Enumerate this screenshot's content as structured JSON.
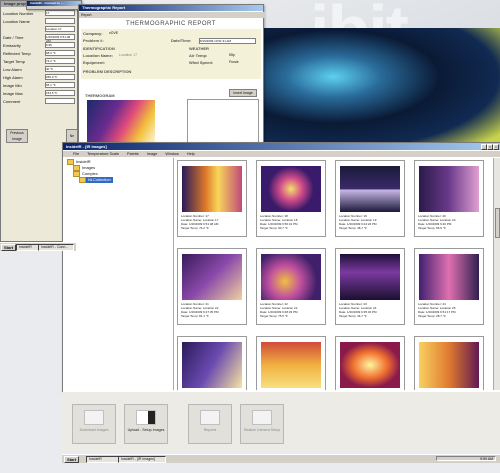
{
  "background_text": "ibit",
  "left_panel": {
    "title": "Image properties",
    "fields": [
      {
        "label": "Location Number",
        "value": "17"
      },
      {
        "label": "Location Name",
        "value": ""
      },
      {
        "label": "",
        "value": "Location 17"
      },
      {
        "label": "Date / Time",
        "value": "1/20/2009 6:51:48 AM"
      },
      {
        "label": "Emissivity",
        "value": "0.95"
      },
      {
        "label": "Reflected Temp",
        "value": "68.0 °F"
      },
      {
        "label": "Target Temp",
        "value": "74.2 °F"
      },
      {
        "label": "Low Alarm",
        "value": "40 °F"
      },
      {
        "label": "High Alarm",
        "value": "266.0 °F"
      },
      {
        "label": "Image Min",
        "value": "66.1 °F"
      },
      {
        "label": "Image Max",
        "value": "153.5 °F"
      },
      {
        "label": "Comment",
        "value": ""
      }
    ],
    "prev_button": "Previous Image",
    "next_button": "Ne"
  },
  "report_window": {
    "title": "Thermographic Report",
    "menu": "Report",
    "heading": "THERMOGRAPHIC REPORT",
    "company_label": "Company:",
    "company_value": "xOVE",
    "problem_label": "Problem #:",
    "datetime_label": "Date/Time:",
    "datetime_value": "5/10/2009 10:51:31 AM",
    "identification": "IDENTIFICATION",
    "weather": "WEATHER",
    "location_name_label": "Location Name:",
    "location_name_value": "Location 17",
    "air_temp_label": "Air Temp:",
    "air_temp_value": "55p",
    "equipment_label": "Equipment:",
    "wind_label": "Wind Speed:",
    "wind_value": "Frosie",
    "problem_desc": "PROBLEM DESCRIPTION",
    "thermogram": "THERMOGRAM",
    "insert_image": "Insert Image"
  },
  "back_window_title": "InsideIR - Connect to ...",
  "main_window": {
    "title": "InsideIR - [IR Images]",
    "menu": [
      "File",
      "Temperature Scale",
      "Palette",
      "Image",
      "Window",
      "Help"
    ],
    "tree": {
      "root": "InsideIR",
      "items": [
        "Images",
        "Complex",
        "NLCollection"
      ]
    },
    "thumbs": [
      {
        "number": "Location Number: 17",
        "name": "Location Name: Location 17",
        "date": "Date: 1/20/2009 6:51:48 AM",
        "temp": "Target Temp: 74.2 °F"
      },
      {
        "number": "Location Number: 18",
        "name": "Location Name: Location 18",
        "date": "Date: 1/20/2009 6:50:31 PM",
        "temp": "Target Temp: 90.7 °F"
      },
      {
        "number": "Location Number: 19",
        "name": "Location Name: Location 19",
        "date": "Date: 1/20/2009 6:44:22 PM",
        "temp": "Target Temp: 48.7 °F"
      },
      {
        "number": "Location Number: 20",
        "name": "Location Name: Location 20",
        "date": "Date: 1/20/2009 6:40 PM",
        "temp": "Target Temp: 56.9 °F"
      },
      {
        "number": "Location Number: 21",
        "name": "Location Name: Location 22",
        "date": "Date: 1/20/2009 6:47:35 PM",
        "temp": "Target Temp: 81.1 °F"
      },
      {
        "number": "Location Number: 22",
        "name": "Location Name: Location 22",
        "date": "Date: 1/20/2009 6:48:33 PM",
        "temp": "Target Temp: 75.5 °F"
      },
      {
        "number": "Location Number: 23",
        "name": "Location Name: Location 24",
        "date": "Date: 1/20/2009 6:35:32 PM",
        "temp": "Target Temp: 46.7 °F"
      },
      {
        "number": "Location Number: 24",
        "name": "Location Name: Location 25",
        "date": "Date: 1/20/2009 6:51:17 PM",
        "temp": "Target Temp: 28.7 °F"
      },
      {
        "number": "",
        "name": "",
        "date": "",
        "temp": ""
      },
      {
        "number": "",
        "name": "",
        "date": "",
        "temp": ""
      },
      {
        "number": "",
        "name": "",
        "date": "",
        "temp": ""
      },
      {
        "number": "",
        "name": "",
        "date": "",
        "temp": ""
      }
    ]
  },
  "bottom_buttons": [
    {
      "label": "Download Images"
    },
    {
      "label": "Upload - Setup Images"
    },
    {
      "label": "Reports"
    },
    {
      "label": "Realize Camera Setup"
    }
  ],
  "taskbar_top": {
    "start": "Start",
    "items": [
      "InsideIR",
      "InsideIR - Conn..."
    ]
  },
  "taskbar_bottom": {
    "start": "Start",
    "items": [
      "InsideIR",
      "InsideIR - [IR Images]"
    ],
    "clock": "9:50 AM"
  }
}
